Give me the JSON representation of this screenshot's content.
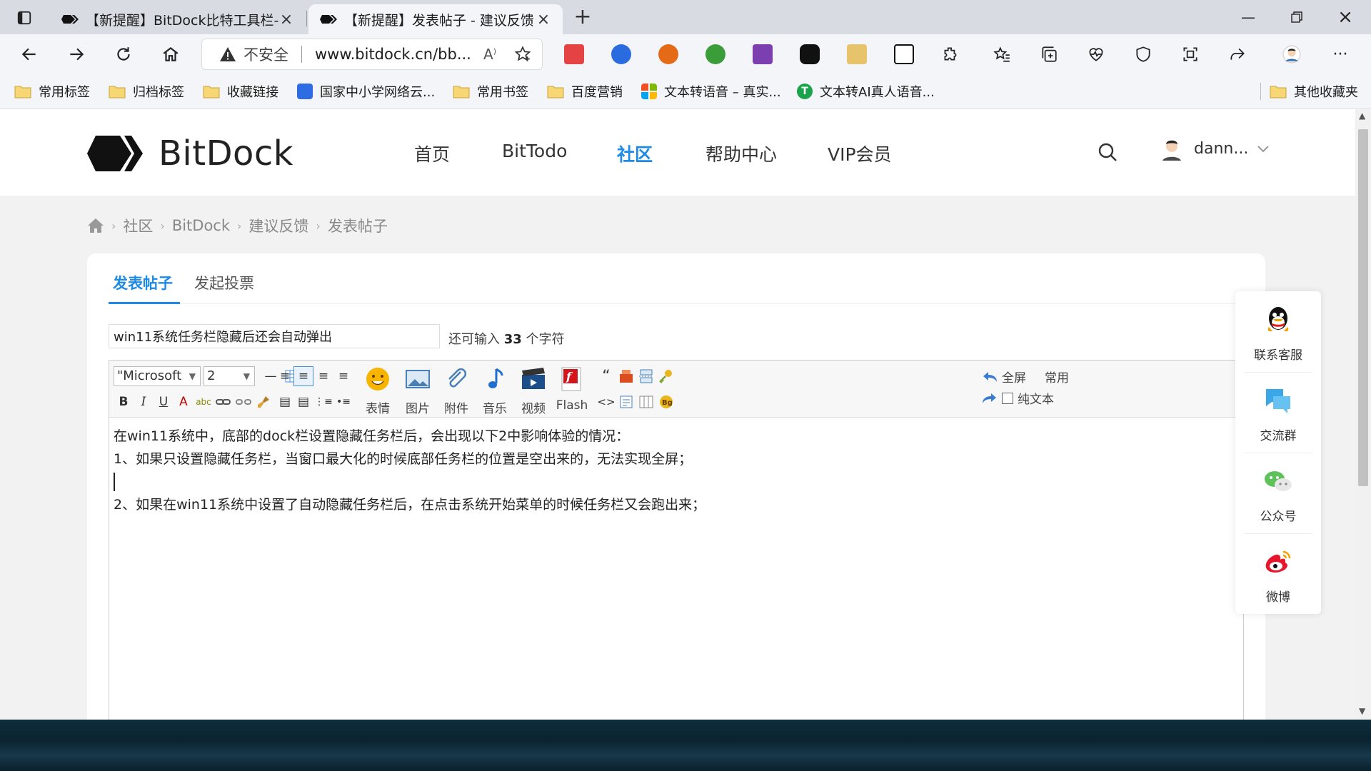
{
  "browser": {
    "tabs": [
      {
        "title": "【新提醒】BitDock比特工具栏-管理",
        "active": false
      },
      {
        "title": "【新提醒】发表帖子 - 建议反馈 - B",
        "active": true
      }
    ],
    "address": {
      "security": "不安全",
      "url": "www.bitdock.cn/bb..."
    },
    "bookmarks": [
      {
        "label": "常用标签",
        "icon": "folder-icon"
      },
      {
        "label": "归档标签",
        "icon": "folder-icon"
      },
      {
        "label": "收藏链接",
        "icon": "folder-icon"
      },
      {
        "label": "国家中小学网络云...",
        "icon": "smartedu-icon"
      },
      {
        "label": "常用书签",
        "icon": "folder-icon"
      },
      {
        "label": "百度营销",
        "icon": "folder-icon"
      },
      {
        "label": "文本转语音 – 真实...",
        "icon": "microsoft-icon"
      },
      {
        "label": "文本转AI真人语音...",
        "icon": "green-t-icon"
      },
      {
        "label": "其他收藏夹",
        "icon": "folder-icon"
      }
    ]
  },
  "site": {
    "brand": "BitDock",
    "nav": [
      "首页",
      "BitTodo",
      "社区",
      "帮助中心",
      "VIP会员"
    ],
    "active_nav": "社区",
    "user": "dann..."
  },
  "breadcrumb": [
    "社区",
    "BitDock",
    "建议反馈",
    "发表帖子"
  ],
  "post": {
    "tabs": [
      "发表帖子",
      "发起投票"
    ],
    "title_value": "win11系统任务栏隐藏后还会自动弹出",
    "hint_prefix": "还可输入",
    "hint_count": "33",
    "hint_suffix": "个字符",
    "toolbar": {
      "font": "\"Microsoft",
      "size": "2",
      "buttons": [
        "表情",
        "图片",
        "附件",
        "音乐",
        "视频",
        "Flash"
      ],
      "fullscreen": "全屏",
      "common": "常用",
      "plaintext": "纯文本"
    },
    "body_lines": [
      "在win11系统中，底部的dock栏设置隐藏任务栏后，会出现以下2中影响体验的情况：",
      "1、如果只设置隐藏任务栏，当窗口最大化的时候底部任务栏的位置是空出来的，无法实现全屏；",
      "",
      "2、如果在win11系统中设置了自动隐藏任务栏后，在点击系统开始菜单的时候任务栏又会跑出来；"
    ]
  },
  "side_panel": [
    {
      "label": "联系客服",
      "icon": "qq-icon"
    },
    {
      "label": "交流群",
      "icon": "chat-group-icon"
    },
    {
      "label": "公众号",
      "icon": "wechat-icon"
    },
    {
      "label": "微博",
      "icon": "weibo-icon"
    }
  ],
  "colors": {
    "accent": "#1e8ae8",
    "tabstrip": "#d8dbe2",
    "page_bg": "#f2f2f2"
  }
}
